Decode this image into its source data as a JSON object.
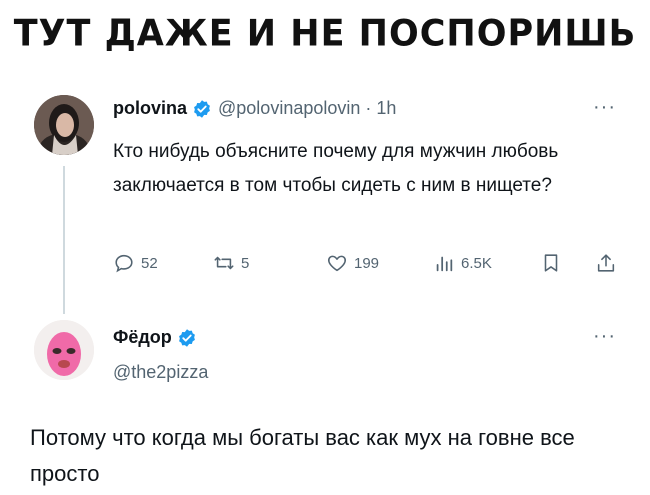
{
  "caption": "ТУТ ДАЖЕ И НЕ ПОСПОРИШЬ",
  "tweet": {
    "author_name": "polovina",
    "author_handle": "@polovinapolovin · 1h",
    "text": "Кто нибудь объясните почему для мужчин любовь заключается в том чтобы сидеть с ним в нищете?",
    "more": "···",
    "replies": "52",
    "retweets": "5",
    "likes": "199",
    "views": "6.5K"
  },
  "reply": {
    "author_name": "Фёдор",
    "author_handle": "@the2pizza",
    "text": "Потому что когда мы богаты вас как мух на говне все просто",
    "more": "···"
  },
  "colors": {
    "verified": "#1d9bf0",
    "muted": "#536471",
    "thread_line": "#cfd9de"
  }
}
